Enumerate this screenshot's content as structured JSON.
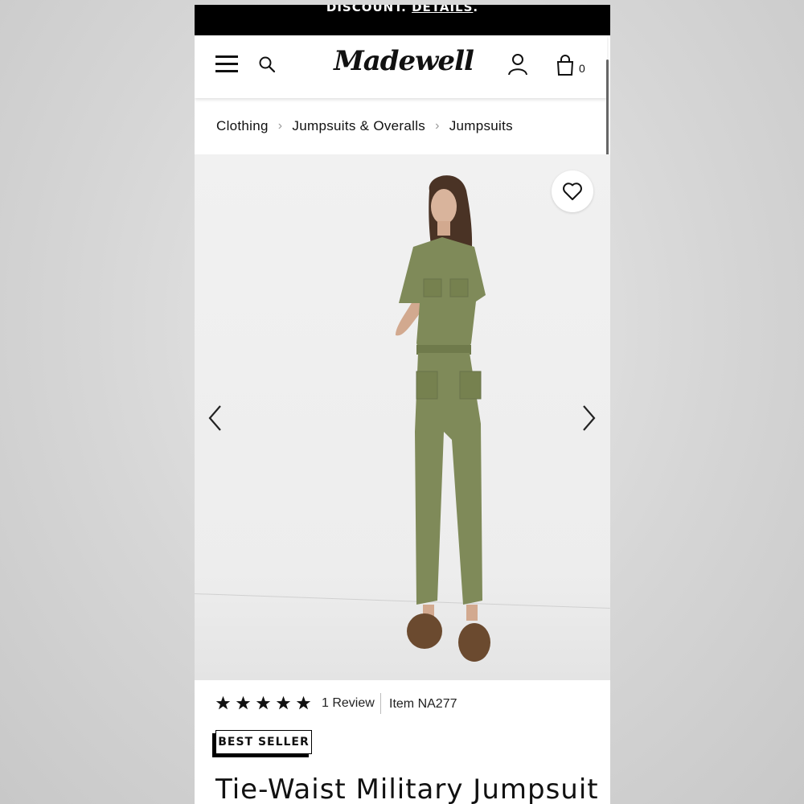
{
  "promo_banner": {
    "text": "DISCOUNT.",
    "link": "DETAILS",
    "trailing": "."
  },
  "header": {
    "logo": "Madewell",
    "bag_count": "0",
    "icons": [
      "menu-icon",
      "search-icon",
      "account-icon",
      "bag-icon"
    ]
  },
  "breadcrumb": {
    "items": [
      "Clothing",
      "Jumpsuits & Overalls",
      "Jumpsuits"
    ],
    "separator": "›"
  },
  "hero": {
    "image_subject": "model wearing olive green tie-waist jumpsuit",
    "icons": [
      "heart-icon",
      "chevron-left-icon",
      "chevron-right-icon"
    ],
    "colors": {
      "jumpsuit": "#7f8a59",
      "shoes": "#6b4a2f",
      "background": "#eeeeee"
    }
  },
  "product": {
    "rating": 5,
    "rating_max": 5,
    "review_text": "1 Review",
    "item_number": "Item NA277",
    "badge": "BEST SELLER",
    "title": "Tie-Waist Military Jumpsuit"
  }
}
